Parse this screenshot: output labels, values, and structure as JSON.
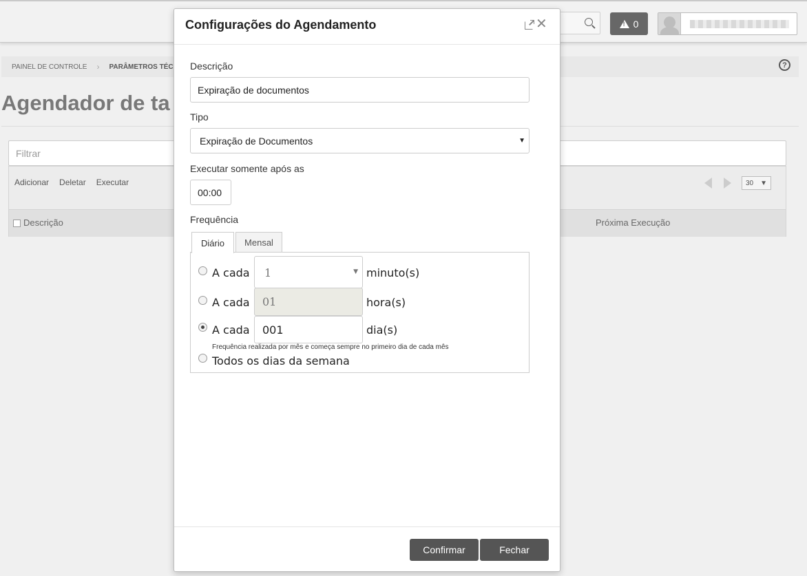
{
  "topbar": {
    "alert_count": "0"
  },
  "breadcrumb": {
    "items": [
      "PAINEL DE CONTROLE",
      "PARÂMETROS TÉCN"
    ]
  },
  "page": {
    "title": "Agendador de ta",
    "filter_placeholder": "Filtrar"
  },
  "grid": {
    "toolbar": [
      "Adicionar",
      "Deletar",
      "Executar"
    ],
    "page_size": "30",
    "columns": [
      "Descrição",
      "Próxima Execução"
    ]
  },
  "modal": {
    "title": "Configurações do Agendamento",
    "close_symbol": "✕",
    "description": {
      "label": "Descrição",
      "value": "Expiração de documentos"
    },
    "type": {
      "label": "Tipo",
      "selected": "Expiração de Documentos"
    },
    "run_after": {
      "label": "Executar somente após as",
      "value": "00:00"
    },
    "frequency": {
      "label": "Frequência",
      "tabs": [
        {
          "label": "Diário",
          "active": true
        },
        {
          "label": "Mensal",
          "active": false
        }
      ],
      "options": [
        {
          "prefix": "A cada",
          "value": "1",
          "unit": "minuto(s)",
          "checked": false,
          "kind": "select"
        },
        {
          "prefix": "A cada",
          "value": "01",
          "unit": "hora(s)",
          "checked": false,
          "kind": "disabled"
        },
        {
          "prefix": "A cada",
          "value": "001",
          "unit": "dia(s)",
          "checked": true,
          "kind": "input"
        }
      ],
      "note": "Frequência realizada por mês e começa sempre no primeiro dia de cada mês",
      "weekdays_label": "Todos os dias da semana"
    },
    "buttons": {
      "confirm": "Confirmar",
      "close": "Fechar"
    }
  }
}
